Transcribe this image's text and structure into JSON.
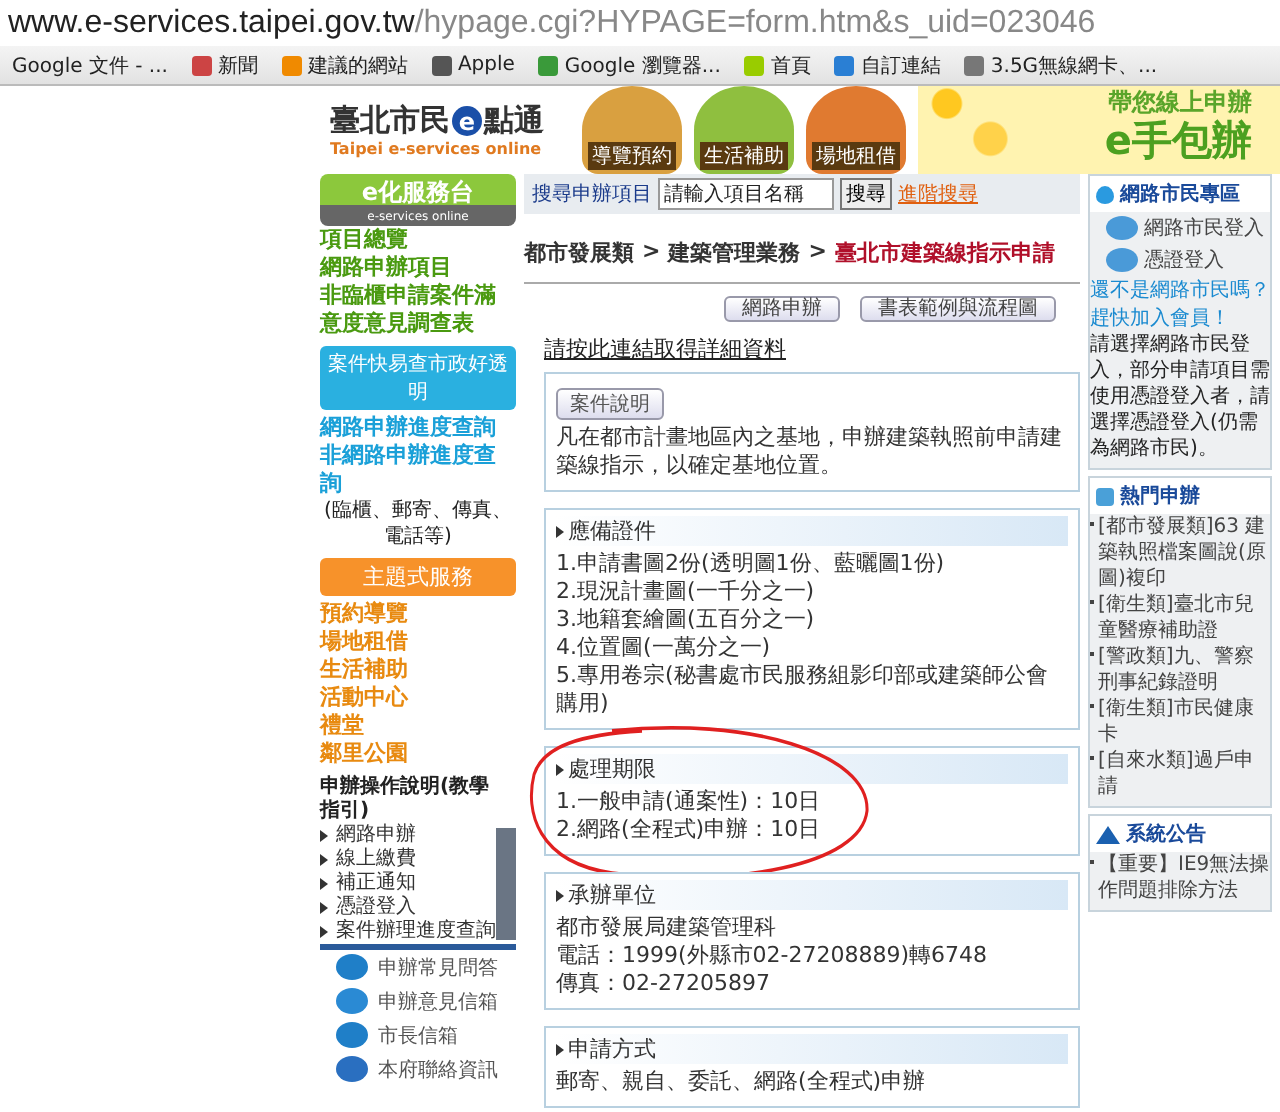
{
  "browser": {
    "url_host": "www.e-services.taipei.gov.tw",
    "url_path": "/hypage.cgi?HYPAGE=form.htm&s_uid=023046",
    "bookmarks": [
      "Google 文件 - ...",
      "新聞",
      "建議的網站",
      "Apple",
      "Google 瀏覽器...",
      "首頁",
      "自訂連結",
      "3.5G無線網卡、..."
    ]
  },
  "banner": {
    "logo_left": "臺北市民",
    "logo_badge": "e",
    "logo_right": "點通",
    "logo_subtitle": "Taipei e-services online",
    "tiles": [
      "導覽預約",
      "生活補助",
      "場地租借"
    ],
    "slogan": "帶您線上申辦",
    "slogan_big": "e手包辦"
  },
  "left_sidebar": {
    "header": {
      "title": "e化服務台",
      "subtitle": "e-services online"
    },
    "links": [
      "項目總覽",
      "網路申辦項目",
      "非臨櫃申請案件滿意度意見調查表"
    ],
    "query_header": "案件快易查市政好透明",
    "query_links": [
      "網路申辦進度查詢",
      "非網路申辦進度查詢"
    ],
    "query_note": "(臨櫃、郵寄、傳真、電話等)",
    "theme_header": "主題式服務",
    "theme_links": [
      "預約導覽",
      "場地租借",
      "生活補助",
      "活動中心",
      "禮堂",
      "鄰里公園"
    ],
    "tutorial": {
      "title": "申辦操作說明(教學指引)",
      "items": [
        "網路申辦",
        "線上繳費",
        "補正通知",
        "憑證登入",
        "案件辦理進度查詢"
      ]
    },
    "icon_links": [
      "申辦常見問答",
      "申辦意見信箱",
      "市長信箱",
      "本府聯絡資訊"
    ]
  },
  "main": {
    "search": {
      "label": "搜尋申辦項目",
      "value": "請輸入項目名稱",
      "button": "搜尋",
      "advanced": "進階搜尋"
    },
    "breadcrumb": [
      {
        "label": "都市發展類",
        "current": false
      },
      {
        "label": "建築管理業務",
        "current": false
      },
      {
        "label": "臺北市建築線指示申請",
        "current": true
      }
    ],
    "separator": ">",
    "buttons": [
      "網路申辦",
      "書表範例與流程圖"
    ],
    "detail_link": "請按此連結取得詳細資料",
    "sections": [
      {
        "kind": "intro",
        "title": "案件說明",
        "lines": [
          "凡在都市計畫地區內之基地，申辦建築執照前申請建築線指示，以確定基地位置。"
        ],
        "circled": false
      },
      {
        "kind": "titled",
        "title": "應備證件",
        "lines": [
          "1.申請書圖2份(透明圖1份、藍曬圖1份)",
          "2.現況計畫圖(一千分之一)",
          "3.地籍套繪圖(五百分之一)",
          "4.位置圖(一萬分之一)",
          "5.專用卷宗(秘書處市民服務組影印部或建築師公會購用)"
        ],
        "circled": false
      },
      {
        "kind": "titled",
        "title": "處理期限",
        "lines": [
          "1.一般申請(通案性)：10日",
          "2.網路(全程式)申辦：10日"
        ],
        "circled": true
      },
      {
        "kind": "titled",
        "title": "承辦單位",
        "lines": [
          "都市發展局建築管理科",
          "電話：1999(外縣市02-27208889)轉6748",
          "傳真：02-27205897"
        ],
        "circled": false
      },
      {
        "kind": "titled",
        "title": "申請方式",
        "lines": [
          "郵寄、親自、委託、網路(全程式)申辦"
        ],
        "circled": false
      }
    ]
  },
  "right_sidebar": {
    "member": {
      "title": "網路市民專區",
      "logins": [
        "網路市民登入",
        "憑證登入"
      ],
      "prompt": "還不是網路市民嗎？",
      "join": "趕快加入會員！",
      "note": "請選擇網路市民登入，部分申請項目需使用憑證登入者，請選擇憑證登入(仍需為網路市民)。"
    },
    "hot": {
      "title": "熱門申辦",
      "items": [
        "[都市發展類]63 建築執照檔案圖說(原圖)複印",
        "[衛生類]臺北市兒童醫療補助證",
        "[警政類]九、警察刑事紀錄證明",
        "[衛生類]市民健康卡",
        "[自來水類]過戶申請"
      ]
    },
    "notice": {
      "title": "系統公告",
      "items": [
        "【重要】IE9無法操作問題排除方法"
      ]
    }
  }
}
